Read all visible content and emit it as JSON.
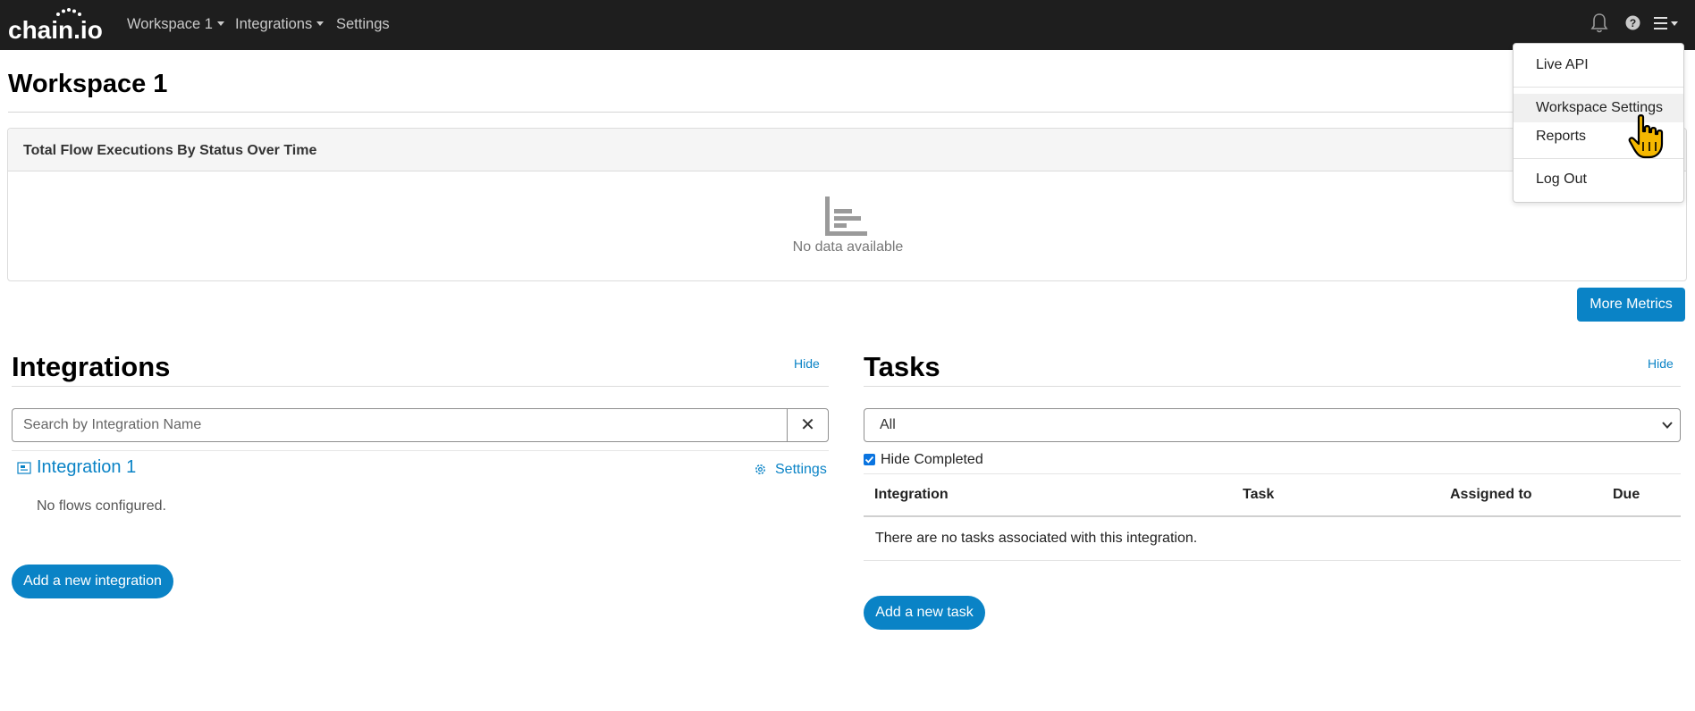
{
  "navbar": {
    "logo_text": "chain.io",
    "workspace_label": "Workspace 1",
    "integrations_label": "Integrations",
    "settings_label": "Settings",
    "icons": [
      "bell-icon",
      "help-icon",
      "hamburger-menu-icon"
    ]
  },
  "page": {
    "title": "Workspace 1"
  },
  "chart_card": {
    "title": "Total Flow Executions By Status Over Time",
    "empty_text": "No data available",
    "icon": "bar-chart-icon"
  },
  "more_metrics_label": "More Metrics",
  "integrations": {
    "title": "Integrations",
    "hide_label": "Hide",
    "search_placeholder": "Search by Integration Name",
    "clear_label": "✕",
    "items": [
      {
        "name": "Integration 1",
        "settings_label": "Settings",
        "empty_text": "No flows configured."
      }
    ],
    "add_label": "Add a new integration"
  },
  "tasks": {
    "title": "Tasks",
    "hide_label": "Hide",
    "filter_value": "All",
    "hide_completed_label": "Hide Completed",
    "hide_completed_checked": true,
    "columns": [
      "Integration",
      "Task",
      "Assigned to",
      "Due"
    ],
    "empty_text": "There are no tasks associated with this integration.",
    "add_label": "Add a new task"
  },
  "user_menu": {
    "items": [
      {
        "label": "Live API"
      },
      {
        "label": "Workspace Settings"
      },
      {
        "label": "Reports"
      },
      {
        "label": "Log Out"
      }
    ],
    "hovered": "Workspace Settings"
  },
  "colors": {
    "navbar_bg": "#1e1e1e",
    "accent": "#0a83c6",
    "checkbox": "#0a74e0"
  }
}
